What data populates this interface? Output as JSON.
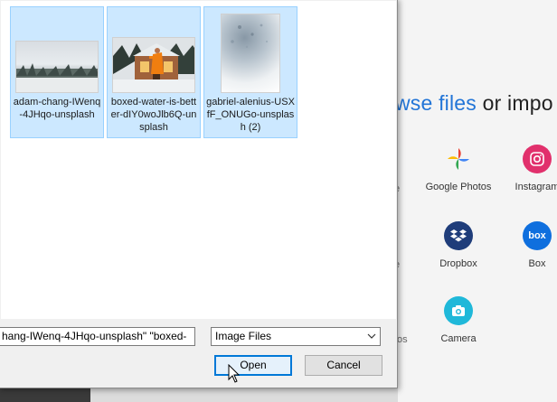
{
  "background": {
    "heading_link": "wse files",
    "heading_rest": " or impo",
    "sources": [
      {
        "label": "Google Photos",
        "icon": "google-photos-icon"
      },
      {
        "label": "Instagram",
        "icon": "instagram-icon"
      },
      {
        "label": "Dropbox",
        "icon": "dropbox-icon"
      },
      {
        "label": "Box",
        "icon": "box-icon"
      },
      {
        "label": "Camera",
        "icon": "camera-icon"
      }
    ],
    "cut_labels": [
      "e",
      "e",
      "tos"
    ],
    "accent": "#2275d7"
  },
  "dialog": {
    "files": [
      {
        "name": "adam-chang-IWenq-4JHqo-unsplash",
        "thumb": "snowy-landscape"
      },
      {
        "name": "boxed-water-is-better-dIY0woJlb6Q-unsplash",
        "thumb": "cabin-person"
      },
      {
        "name": "gabriel-alenius-USXfF_ONUGo-unsplash (2)",
        "thumb": "snow-blur"
      }
    ],
    "filename_value": "hang-IWenq-4JHqo-unsplash\" \"boxed-",
    "filter_value": "Image Files",
    "open_label": "Open",
    "cancel_label": "Cancel"
  }
}
